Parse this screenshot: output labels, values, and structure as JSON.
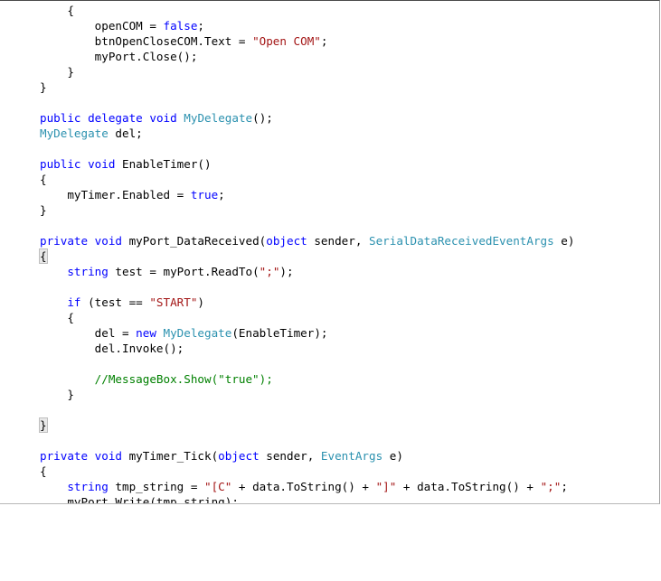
{
  "editor": {
    "lines": [
      {
        "indent": "    ",
        "tokens": [
          {
            "t": "{",
            "c": "pl"
          }
        ]
      },
      {
        "indent": "        ",
        "tokens": [
          {
            "t": "openCOM = ",
            "c": "pl"
          },
          {
            "t": "false",
            "c": "kw"
          },
          {
            "t": ";",
            "c": "pl"
          }
        ]
      },
      {
        "indent": "        ",
        "tokens": [
          {
            "t": "btnOpenCloseCOM.Text = ",
            "c": "pl"
          },
          {
            "t": "\"Open COM\"",
            "c": "st"
          },
          {
            "t": ";",
            "c": "pl"
          }
        ]
      },
      {
        "indent": "        ",
        "tokens": [
          {
            "t": "myPort.Close();",
            "c": "pl"
          }
        ]
      },
      {
        "indent": "    ",
        "tokens": [
          {
            "t": "}",
            "c": "pl"
          }
        ]
      },
      {
        "indent": "",
        "tokens": [
          {
            "t": "}",
            "c": "pl"
          }
        ]
      },
      {
        "indent": "",
        "tokens": []
      },
      {
        "indent": "",
        "tokens": [
          {
            "t": "public",
            "c": "kw"
          },
          {
            "t": " ",
            "c": "pl"
          },
          {
            "t": "delegate",
            "c": "kw"
          },
          {
            "t": " ",
            "c": "pl"
          },
          {
            "t": "void",
            "c": "kw"
          },
          {
            "t": " ",
            "c": "pl"
          },
          {
            "t": "MyDelegate",
            "c": "ty"
          },
          {
            "t": "();",
            "c": "pl"
          }
        ]
      },
      {
        "indent": "",
        "tokens": [
          {
            "t": "MyDelegate",
            "c": "ty"
          },
          {
            "t": " del;",
            "c": "pl"
          }
        ]
      },
      {
        "indent": "",
        "tokens": []
      },
      {
        "indent": "",
        "tokens": [
          {
            "t": "public",
            "c": "kw"
          },
          {
            "t": " ",
            "c": "pl"
          },
          {
            "t": "void",
            "c": "kw"
          },
          {
            "t": " EnableTimer()",
            "c": "pl"
          }
        ]
      },
      {
        "indent": "",
        "tokens": [
          {
            "t": "{",
            "c": "pl"
          }
        ]
      },
      {
        "indent": "    ",
        "tokens": [
          {
            "t": "myTimer.Enabled = ",
            "c": "pl"
          },
          {
            "t": "true",
            "c": "kw"
          },
          {
            "t": ";",
            "c": "pl"
          }
        ]
      },
      {
        "indent": "",
        "tokens": [
          {
            "t": "}",
            "c": "pl"
          }
        ]
      },
      {
        "indent": "",
        "tokens": []
      },
      {
        "indent": "",
        "tokens": [
          {
            "t": "private",
            "c": "kw"
          },
          {
            "t": " ",
            "c": "pl"
          },
          {
            "t": "void",
            "c": "kw"
          },
          {
            "t": " myPort_DataReceived(",
            "c": "pl"
          },
          {
            "t": "object",
            "c": "kw"
          },
          {
            "t": " sender, ",
            "c": "pl"
          },
          {
            "t": "SerialDataReceivedEventArgs",
            "c": "ty"
          },
          {
            "t": " e)",
            "c": "pl"
          }
        ]
      },
      {
        "indent": "",
        "tokens": [
          {
            "t": "{",
            "c": "brace"
          }
        ]
      },
      {
        "indent": "    ",
        "tokens": [
          {
            "t": "string",
            "c": "kw"
          },
          {
            "t": " test = myPort.ReadTo(",
            "c": "pl"
          },
          {
            "t": "\";\"",
            "c": "st"
          },
          {
            "t": ");",
            "c": "pl"
          }
        ]
      },
      {
        "indent": "",
        "tokens": []
      },
      {
        "indent": "    ",
        "tokens": [
          {
            "t": "if",
            "c": "kw"
          },
          {
            "t": " (test == ",
            "c": "pl"
          },
          {
            "t": "\"START\"",
            "c": "st"
          },
          {
            "t": ")",
            "c": "pl"
          }
        ]
      },
      {
        "indent": "    ",
        "tokens": [
          {
            "t": "{",
            "c": "pl"
          }
        ]
      },
      {
        "indent": "        ",
        "tokens": [
          {
            "t": "del = ",
            "c": "pl"
          },
          {
            "t": "new",
            "c": "kw"
          },
          {
            "t": " ",
            "c": "pl"
          },
          {
            "t": "MyDelegate",
            "c": "ty"
          },
          {
            "t": "(EnableTimer);",
            "c": "pl"
          }
        ]
      },
      {
        "indent": "        ",
        "tokens": [
          {
            "t": "del.Invoke();",
            "c": "pl"
          }
        ]
      },
      {
        "indent": "",
        "tokens": []
      },
      {
        "indent": "        ",
        "tokens": [
          {
            "t": "//MessageBox.Show(\"true\");",
            "c": "cm"
          }
        ]
      },
      {
        "indent": "    ",
        "tokens": [
          {
            "t": "}",
            "c": "pl"
          }
        ]
      },
      {
        "indent": "",
        "tokens": []
      },
      {
        "indent": "",
        "tokens": [
          {
            "t": "}",
            "c": "brace"
          },
          {
            "t": "",
            "c": "caret"
          }
        ]
      },
      {
        "indent": "",
        "tokens": []
      },
      {
        "indent": "",
        "tokens": [
          {
            "t": "private",
            "c": "kw"
          },
          {
            "t": " ",
            "c": "pl"
          },
          {
            "t": "void",
            "c": "kw"
          },
          {
            "t": " myTimer_Tick(",
            "c": "pl"
          },
          {
            "t": "object",
            "c": "kw"
          },
          {
            "t": " sender, ",
            "c": "pl"
          },
          {
            "t": "EventArgs",
            "c": "ty"
          },
          {
            "t": " e)",
            "c": "pl"
          }
        ]
      },
      {
        "indent": "",
        "tokens": [
          {
            "t": "{",
            "c": "pl"
          }
        ]
      },
      {
        "indent": "    ",
        "tokens": [
          {
            "t": "string",
            "c": "kw"
          },
          {
            "t": " tmp_string = ",
            "c": "pl"
          },
          {
            "t": "\"[C\"",
            "c": "st"
          },
          {
            "t": " + data.ToString() + ",
            "c": "pl"
          },
          {
            "t": "\"]\"",
            "c": "st"
          },
          {
            "t": " + data.ToString() + ",
            "c": "pl"
          },
          {
            "t": "\";\"",
            "c": "st"
          },
          {
            "t": ";",
            "c": "pl"
          }
        ]
      },
      {
        "indent": "    ",
        "tokens": [
          {
            "t": "myPort.Write(tmp_string);",
            "c": "pl"
          }
        ]
      }
    ]
  },
  "colors": {
    "keyword": "#0000ff",
    "type": "#2b91af",
    "string": "#a31515",
    "comment": "#008000",
    "plain": "#000000"
  }
}
